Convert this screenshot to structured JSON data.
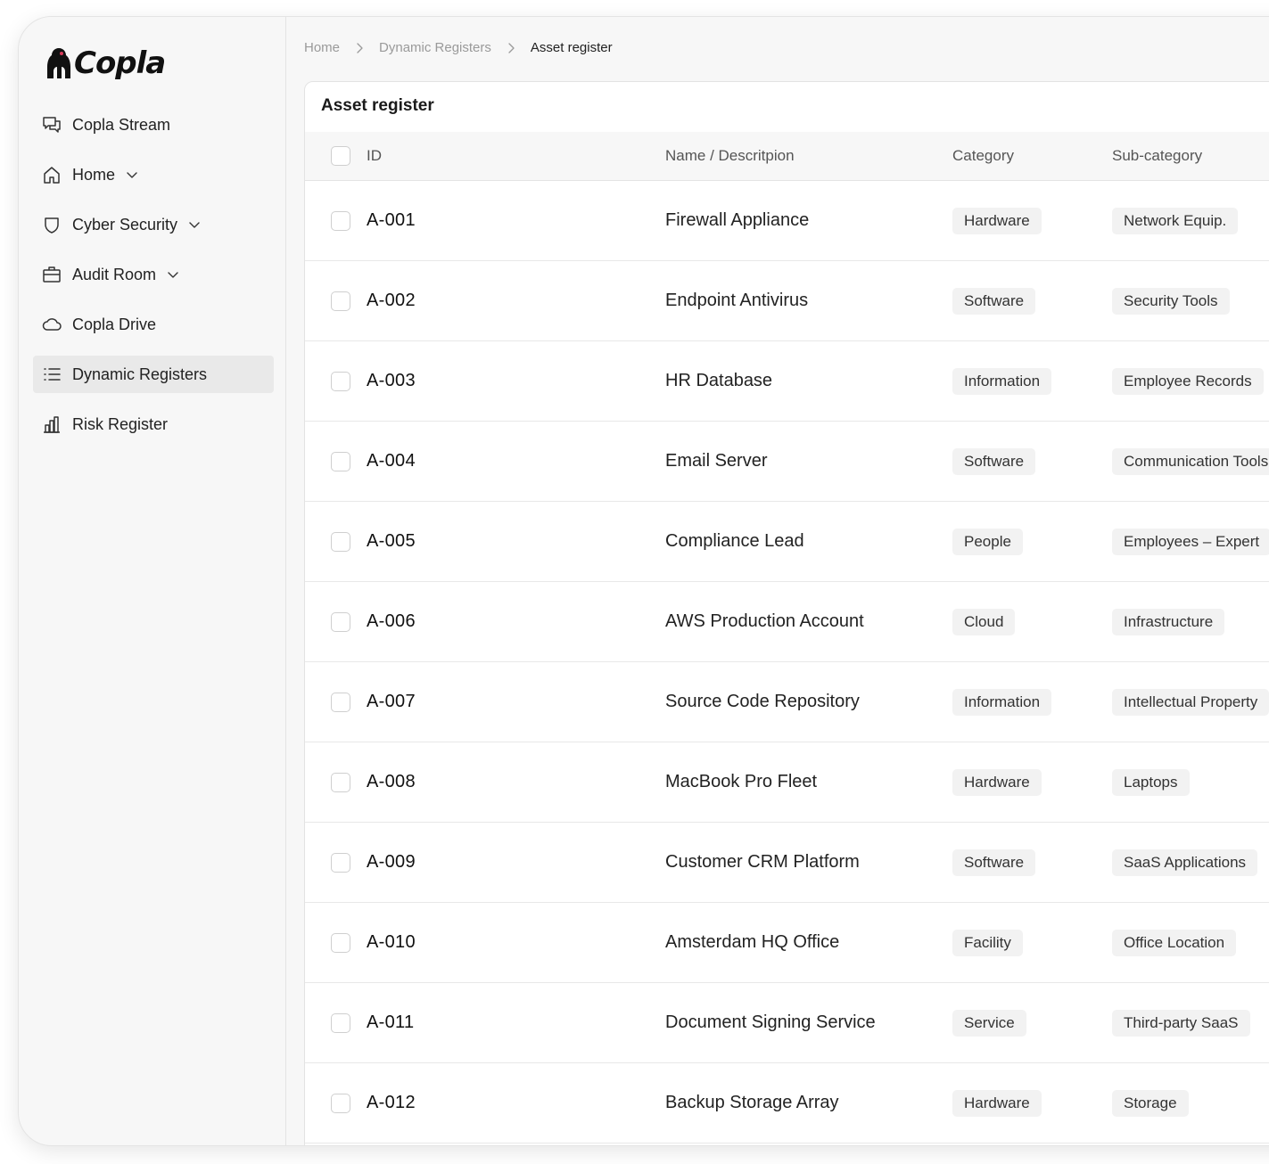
{
  "app": {
    "brand": "Copla"
  },
  "sidebar": {
    "items": [
      {
        "label": "Copla Stream",
        "icon": "chat-icon",
        "has_chevron": false,
        "active": false
      },
      {
        "label": "Home",
        "icon": "home-icon",
        "has_chevron": true,
        "active": false
      },
      {
        "label": "Cyber Security",
        "icon": "shield-icon",
        "has_chevron": true,
        "active": false
      },
      {
        "label": "Audit Room",
        "icon": "briefcase-icon",
        "has_chevron": true,
        "active": false
      },
      {
        "label": "Copla Drive",
        "icon": "cloud-icon",
        "has_chevron": false,
        "active": false
      },
      {
        "label": "Dynamic Registers",
        "icon": "list-icon",
        "has_chevron": false,
        "active": true
      },
      {
        "label": "Risk Register",
        "icon": "bar-chart-icon",
        "has_chevron": false,
        "active": false
      }
    ]
  },
  "breadcrumb": {
    "items": [
      "Home",
      "Dynamic Registers",
      "Asset register"
    ]
  },
  "register": {
    "title": "Asset register",
    "columns": {
      "id": "ID",
      "name": "Name / Descritpion",
      "category": "Category",
      "subcategory": "Sub-category"
    },
    "rows": [
      {
        "id": "A-001",
        "name": "Firewall Appliance",
        "category": "Hardware",
        "subcategory": "Network Equip."
      },
      {
        "id": "A-002",
        "name": "Endpoint Antivirus",
        "category": "Software",
        "subcategory": "Security Tools"
      },
      {
        "id": "A-003",
        "name": "HR Database",
        "category": "Information",
        "subcategory": "Employee Records"
      },
      {
        "id": "A-004",
        "name": "Email Server",
        "category": "Software",
        "subcategory": "Communication Tools"
      },
      {
        "id": "A-005",
        "name": "Compliance Lead",
        "category": "People",
        "subcategory": "Employees – Expert"
      },
      {
        "id": "A-006",
        "name": "AWS Production Account",
        "category": "Cloud",
        "subcategory": "Infrastructure"
      },
      {
        "id": "A-007",
        "name": "Source Code Repository",
        "category": "Information",
        "subcategory": "Intellectual Property"
      },
      {
        "id": "A-008",
        "name": "MacBook Pro Fleet",
        "category": "Hardware",
        "subcategory": "Laptops"
      },
      {
        "id": "A-009",
        "name": "Customer CRM Platform",
        "category": "Software",
        "subcategory": "SaaS Applications"
      },
      {
        "id": "A-010",
        "name": "Amsterdam HQ Office",
        "category": "Facility",
        "subcategory": "Office Location"
      },
      {
        "id": "A-011",
        "name": "Document Signing Service",
        "category": "Service",
        "subcategory": "Third-party SaaS"
      },
      {
        "id": "A-012",
        "name": "Backup Storage Array",
        "category": "Hardware",
        "subcategory": "Storage"
      }
    ]
  }
}
